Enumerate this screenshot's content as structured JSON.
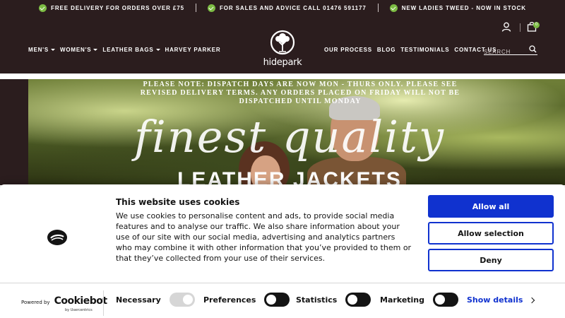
{
  "promo": {
    "items": [
      "FREE DELIVERY FOR ORDERS OVER £75",
      "FOR SALES AND ADVICE CALL 01476 591177",
      "NEW LADIES TWEED - NOW IN STOCK"
    ]
  },
  "header": {
    "nav_left": [
      "MEN'S",
      "WOMEN'S",
      "LEATHER BAGS",
      "HARVEY PARKER"
    ],
    "nav_right": [
      "OUR PROCESS",
      "BLOG",
      "TESTIMONIALS",
      "CONTACT US"
    ],
    "logo_text": "hidepark",
    "search_placeholder": "SEARCH",
    "cart_count": "0"
  },
  "hero": {
    "notice": "PLEASE NOTE: DISPATCH DAYS ARE NOW MON - THURS ONLY. PLEASE SEE REVISED DELIVERY TERMS. ANY ORDERS PLACED ON FRIDAY WILL NOT BE DISPATCHED UNTIL MONDAY",
    "script_title": "finest quality",
    "bold_title": "LEATHER JACKETS"
  },
  "cookie": {
    "title": "This website uses cookies",
    "text": "We use cookies to personalise content and ads, to provide social media features and to analyse our traffic. We also share information about your use of our site with our social media, advertising and analytics partners who may combine it with other information that you’ve provided to them or that they’ve collected from your use of their services.",
    "allow_all": "Allow all",
    "allow_selection": "Allow selection",
    "deny": "Deny",
    "powered_by": "Powered by",
    "brand": "Cookiebot",
    "brand_sub": "by Usercentrics",
    "toggles": {
      "necessary": "Necessary",
      "preferences": "Preferences",
      "statistics": "Statistics",
      "marketing": "Marketing"
    },
    "show_details": "Show details"
  }
}
